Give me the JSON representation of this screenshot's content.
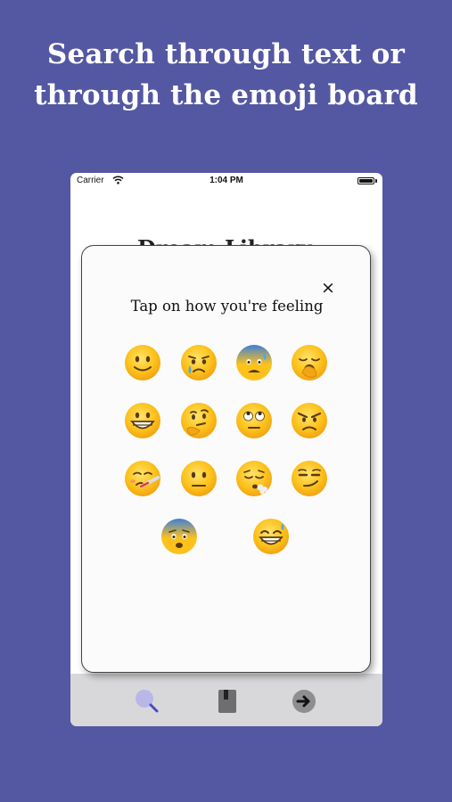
{
  "headline": {
    "line1": "Search through text or",
    "line2": "through the emoji board"
  },
  "status_bar": {
    "carrier": "Carrier",
    "time": "1:04 PM"
  },
  "page": {
    "title": "Dream Library"
  },
  "modal": {
    "title": "Tap on how you're feeling",
    "close_label": "×",
    "emojis": [
      "slightly-smiling-face",
      "crying-face",
      "anxious-face-with-sweat",
      "yawning-face",
      "grinning-face",
      "thinking-face",
      "face-with-rolling-eyes",
      "angry-face",
      "face-with-thermometer",
      "neutral-face",
      "face-exhaling",
      "smirking-face",
      "fearful-face",
      "grinning-face-with-sweat"
    ]
  },
  "tab_bar": {
    "icons": [
      "search-icon",
      "book-icon",
      "arrow-right-circle-icon"
    ]
  },
  "colors": {
    "background": "#5457a2",
    "headline_text": "#ffffff",
    "tab_bar": "#d8d8da",
    "icon_purple": "#b9b7e8",
    "emoji_yellow": "#fcc21b"
  }
}
